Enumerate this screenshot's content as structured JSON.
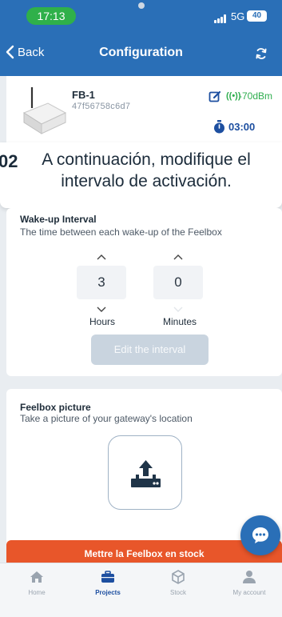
{
  "status_bar": {
    "time": "17:13",
    "network": "5G",
    "battery": "40"
  },
  "header": {
    "back_label": "Back",
    "title": "Configuration"
  },
  "device": {
    "name": "FB-1",
    "id": "47f56758c6d7",
    "signal": "-70dBm",
    "timer": "03:00"
  },
  "instruction": {
    "number": "02",
    "text": "A continuación, modifique el intervalo de activación."
  },
  "wakeup": {
    "title": "Wake-up Interval",
    "subtitle": "The time between each wake-up of the Feelbox",
    "hours_value": "3",
    "minutes_value": "0",
    "hours_label": "Hours",
    "minutes_label": "Minutes",
    "edit_button": "Edit the interval"
  },
  "picture": {
    "title": "Feelbox picture",
    "subtitle": "Take a picture of your gateway's location"
  },
  "stock_button": "Mettre la Feelbox en stock",
  "nav": {
    "home": "Home",
    "projects": "Projects",
    "stock": "Stock",
    "account": "My account"
  },
  "colors": {
    "primary": "#2a6fb7",
    "accent": "#e8562a",
    "signal": "#2fae4f"
  }
}
